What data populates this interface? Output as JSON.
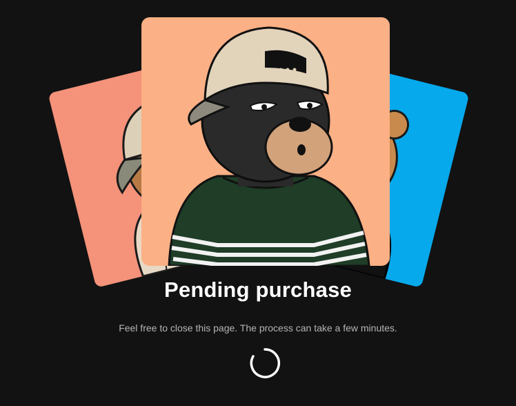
{
  "status": {
    "title": "Pending purchase",
    "message": "Feel free to close this page. The process can take a few minutes."
  },
  "cards": [
    {
      "position": "left",
      "background": "#f4927a",
      "subject": "bear-with-cap-and-hoodie"
    },
    {
      "position": "center",
      "background": "#fbb085",
      "subject": "black-bear-with-cap-and-striped-shirt"
    },
    {
      "position": "right",
      "background": "#06a9ec",
      "subject": "brown-bear-with-glasses-and-jacket"
    }
  ],
  "spinner": {
    "icon": "loading-spinner-icon",
    "color": "#ffffff"
  }
}
